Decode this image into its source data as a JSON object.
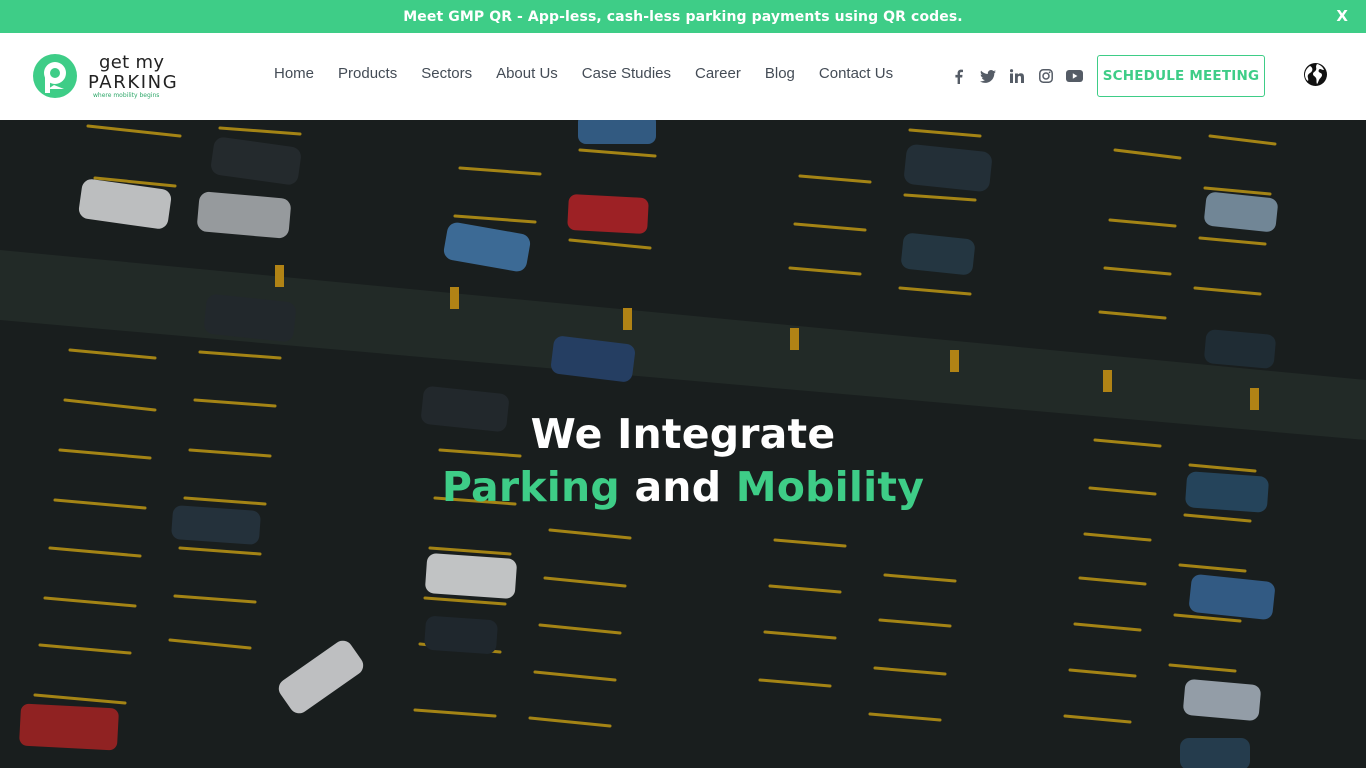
{
  "announcement": {
    "text": "Meet GMP QR - App-less, cash-less parking payments using QR codes.",
    "close_label": "X"
  },
  "brand": {
    "line1": "get my",
    "line2": "PARKING",
    "tagline": "where mobility begins",
    "color": "#3ecd87"
  },
  "nav": {
    "items": [
      "Home",
      "Products",
      "Sectors",
      "About Us",
      "Case Studies",
      "Career",
      "Blog",
      "Contact Us"
    ]
  },
  "socials": [
    "facebook-icon",
    "twitter-icon",
    "linkedin-icon",
    "instagram-icon",
    "youtube-icon"
  ],
  "cta": {
    "label": "SCHEDULE MEETING"
  },
  "hero": {
    "line1": "We Integrate",
    "word_parking": "Parking",
    "word_and": "and",
    "word_mobility": "Mobility",
    "background": "aerial view of parking lot"
  }
}
